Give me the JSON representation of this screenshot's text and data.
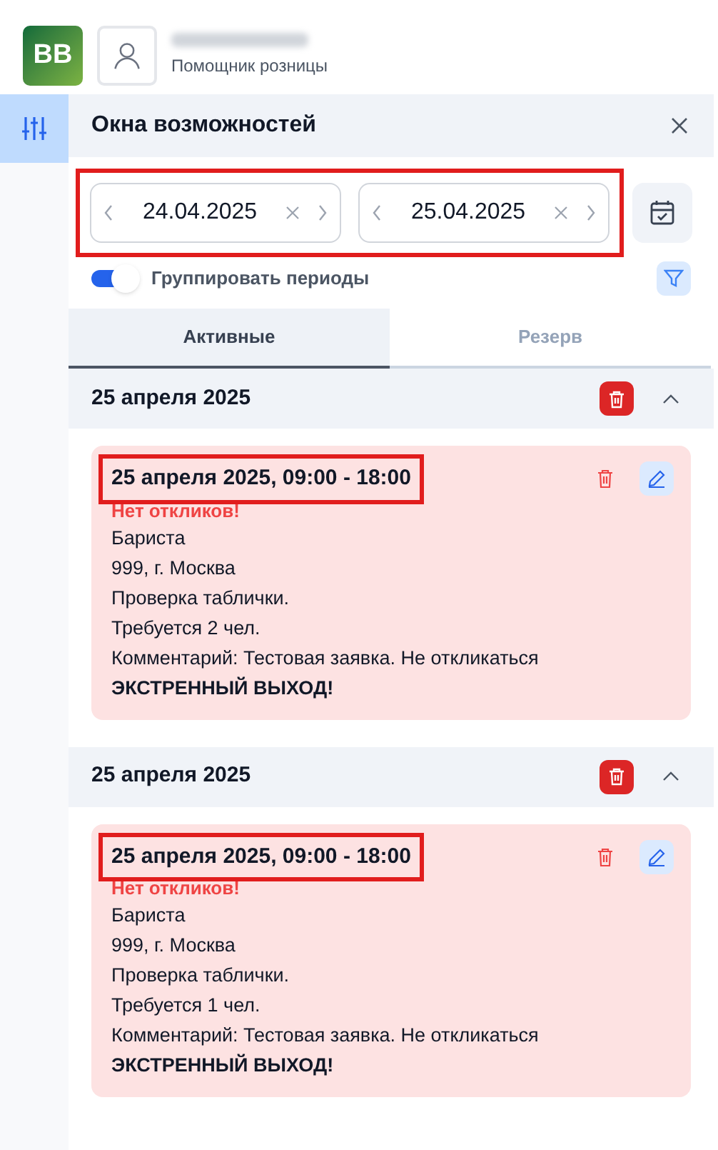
{
  "app": {
    "logo": "BB",
    "role": "Помощник розницы"
  },
  "panel": {
    "title": "Окна возможностей"
  },
  "date_range": {
    "highlighted": true,
    "from": "24.04.2025",
    "to": "25.04.2025"
  },
  "group_periods": {
    "label": "Группировать периоды",
    "on": true
  },
  "tabs": [
    {
      "label": "Активные",
      "selected": true
    },
    {
      "label": "Резерв",
      "selected": false
    }
  ],
  "groups": [
    {
      "title": "25 апреля 2025",
      "expanded": true,
      "cards": [
        {
          "title": "25 апреля 2025, 09:00 - 18:00",
          "title_highlighted": true,
          "alert": "Нет откликов!",
          "lines": [
            "Бариста",
            "999, г. Москва",
            "Проверка таблички.",
            "Требуется 2 чел.",
            "Комментарий: Тестовая заявка. Не откликаться"
          ],
          "emphasis": "ЭКСТРЕННЫЙ ВЫХОД!"
        }
      ]
    },
    {
      "title": "25 апреля 2025",
      "expanded": true,
      "cards": [
        {
          "title": "25 апреля 2025, 09:00 - 18:00",
          "title_highlighted": true,
          "alert": "Нет откликов!",
          "lines": [
            "Бариста",
            "999, г. Москва",
            "Проверка таблички.",
            "Требуется 1 чел.",
            "Комментарий: Тестовая заявка. Не откликаться"
          ],
          "emphasis": "ЭКСТРЕННЫЙ ВЫХОД!"
        }
      ]
    }
  ]
}
